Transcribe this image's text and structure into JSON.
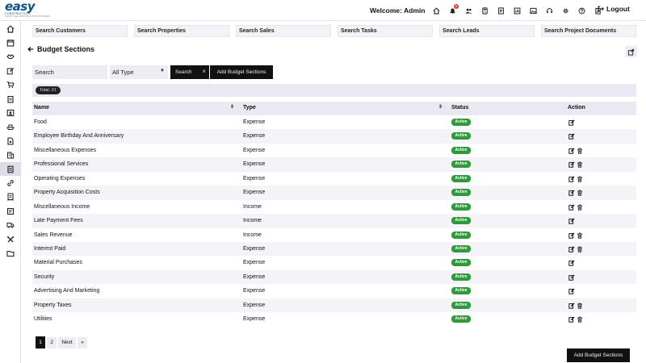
{
  "brand": {
    "logo_word": "easy",
    "logo_sub": "CONSTRUCTION",
    "logo_tag": "THINK THE CONSTRUCTION TOOLBOX"
  },
  "header": {
    "welcome": "Welcome: Admin",
    "notification_count": "8",
    "logout_label": "Logout",
    "icons": [
      "home-icon",
      "bell-icon",
      "users-icon",
      "calculator-icon",
      "document-icon",
      "chart-icon",
      "image-icon",
      "headset-icon",
      "settings-icon",
      "help-icon",
      "clipboard-icon"
    ]
  },
  "sidebar": {
    "items": [
      "home-icon",
      "calendar-icon",
      "handshake-icon",
      "edit-icon",
      "cart-icon",
      "clipboard-icon",
      "phone-icon",
      "ship-icon",
      "file-icon",
      "building-icon",
      "budget-icon",
      "link-icon",
      "receipt-icon",
      "invoice-icon",
      "truck-icon",
      "tools-icon",
      "folder-icon"
    ],
    "active_index": 10
  },
  "search_shortcuts": [
    "Search Customers",
    "Search Properties",
    "Search Sales",
    "Search Tasks",
    "Search Leads",
    "Search Project Documents"
  ],
  "page": {
    "title": "Budget Sections"
  },
  "filters": {
    "search_value": "Search",
    "type_selected": "All Type",
    "search_button": "Search",
    "add_button": "Add Budget Sections"
  },
  "total_label": "Total: 21",
  "table": {
    "columns": [
      "Name",
      "Type",
      "Status",
      "Action"
    ],
    "rows": [
      {
        "name": "Food",
        "type": "Expense",
        "status": "Active",
        "delete": false
      },
      {
        "name": "Employee Birthday And Anniversary",
        "type": "Expense",
        "status": "Active",
        "delete": false
      },
      {
        "name": "Miscellaneous Expenses",
        "type": "Expense",
        "status": "Active",
        "delete": true
      },
      {
        "name": "Professional Services",
        "type": "Expense",
        "status": "Active",
        "delete": true
      },
      {
        "name": "Operating Expenses",
        "type": "Expense",
        "status": "Active",
        "delete": true
      },
      {
        "name": "Property Acquisition Costs",
        "type": "Expense",
        "status": "Active",
        "delete": true
      },
      {
        "name": "Miscellaneous Income",
        "type": "Income",
        "status": "Active",
        "delete": true
      },
      {
        "name": "Late Payment Fees",
        "type": "Income",
        "status": "Active",
        "delete": false
      },
      {
        "name": "Sales Revenue",
        "type": "Income",
        "status": "Active",
        "delete": true
      },
      {
        "name": "Interest Paid",
        "type": "Expense",
        "status": "Active",
        "delete": true
      },
      {
        "name": "Material Purchases",
        "type": "Expense",
        "status": "Active",
        "delete": false
      },
      {
        "name": "Security",
        "type": "Expense",
        "status": "Active",
        "delete": false
      },
      {
        "name": "Advertising And Marketing",
        "type": "Expense",
        "status": "Active",
        "delete": false
      },
      {
        "name": "Property Taxes",
        "type": "Expense",
        "status": "Active",
        "delete": true
      },
      {
        "name": "Utilities",
        "type": "Expense",
        "status": "Active",
        "delete": true
      }
    ]
  },
  "pagination": {
    "pages": [
      "1",
      "2"
    ],
    "current": "1",
    "next_label": "Next",
    "last_label": "»"
  },
  "bottom_add_button": "Add Budget Sections",
  "colors": {
    "accent_dark": "#111111",
    "status_active": "#2e9b3a",
    "brand_blue": "#0e4f86",
    "page_bg": "#e3e4f0"
  }
}
